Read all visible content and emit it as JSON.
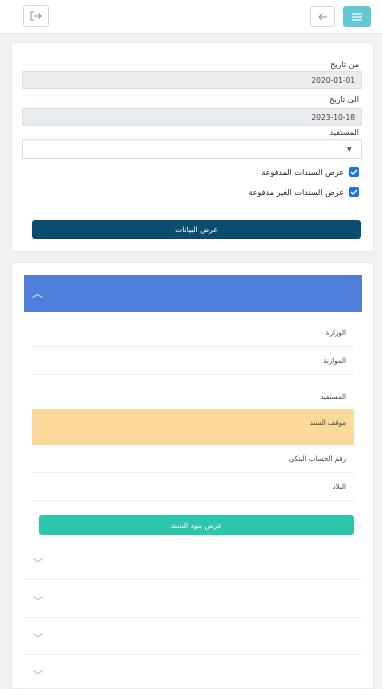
{
  "topbar": {
    "exit_icon": "sign-out-icon",
    "back_icon": "arrow-left-icon",
    "menu_icon": "menu-icon"
  },
  "filter": {
    "from_date_label": "من تاريخ",
    "from_date_value": "2020-01-01",
    "to_date_label": "الى تاريخ",
    "to_date_value": "2023-10-18",
    "beneficiary_label": "المستفيد",
    "check_paid_label": "عرض السندات المدفوعة",
    "check_unpaid_label": "عرض السندات الغير مدفوعة",
    "show_button": "عرض البيانات"
  },
  "record": {
    "rows": [
      "الوزارة",
      "الموازنة",
      "المستفيد",
      "موقف السند",
      "رقم الحساب البنكي",
      "البلاد"
    ],
    "items_button": "عرض بنود السند"
  },
  "colors": {
    "accent_blue": "#4f7fda",
    "dark_button": "#0b4d6e",
    "teal_button": "#2cc7aa",
    "highlight": "#fbd99a",
    "menu_button": "#63c7d6"
  }
}
